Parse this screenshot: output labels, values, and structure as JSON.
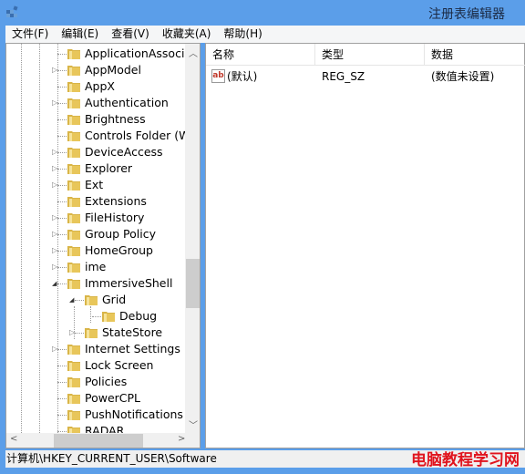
{
  "window": {
    "title": "注册表编辑器",
    "icon": "registry-editor-icon"
  },
  "menu": [
    "文件(F)",
    "编辑(E)",
    "查看(V)",
    "收藏夹(A)",
    "帮助(H)"
  ],
  "tree": [
    {
      "label": "ApplicationAssocia",
      "level": 0,
      "expander": "none"
    },
    {
      "label": "AppModel",
      "level": 0,
      "expander": "collapsed"
    },
    {
      "label": "AppX",
      "level": 0,
      "expander": "none"
    },
    {
      "label": "Authentication",
      "level": 0,
      "expander": "collapsed"
    },
    {
      "label": "Brightness",
      "level": 0,
      "expander": "none"
    },
    {
      "label": "Controls Folder (W",
      "level": 0,
      "expander": "none"
    },
    {
      "label": "DeviceAccess",
      "level": 0,
      "expander": "collapsed"
    },
    {
      "label": "Explorer",
      "level": 0,
      "expander": "collapsed"
    },
    {
      "label": "Ext",
      "level": 0,
      "expander": "collapsed"
    },
    {
      "label": "Extensions",
      "level": 0,
      "expander": "none"
    },
    {
      "label": "FileHistory",
      "level": 0,
      "expander": "collapsed"
    },
    {
      "label": "Group Policy",
      "level": 0,
      "expander": "collapsed"
    },
    {
      "label": "HomeGroup",
      "level": 0,
      "expander": "collapsed"
    },
    {
      "label": "ime",
      "level": 0,
      "expander": "collapsed"
    },
    {
      "label": "ImmersiveShell",
      "level": 0,
      "expander": "expanded"
    },
    {
      "label": "Grid",
      "level": 1,
      "expander": "expanded"
    },
    {
      "label": "Debug",
      "level": 2,
      "expander": "none"
    },
    {
      "label": "StateStore",
      "level": 1,
      "expander": "collapsed"
    },
    {
      "label": "Internet Settings",
      "level": 0,
      "expander": "collapsed"
    },
    {
      "label": "Lock Screen",
      "level": 0,
      "expander": "none"
    },
    {
      "label": "Policies",
      "level": 0,
      "expander": "none"
    },
    {
      "label": "PowerCPL",
      "level": 0,
      "expander": "none"
    },
    {
      "label": "PushNotifications",
      "level": 0,
      "expander": "none"
    },
    {
      "label": "RADAR",
      "level": 0,
      "expander": "none"
    }
  ],
  "list": {
    "columns": [
      "名称",
      "类型",
      "数据"
    ],
    "rows": [
      {
        "name": "(默认)",
        "type": "REG_SZ",
        "data": "(数值未设置)",
        "icon": "ab"
      }
    ]
  },
  "status": "计算机\\HKEY_CURRENT_USER\\Software",
  "watermark": "电脑教程学习网",
  "colors": {
    "titlebar": "#5b9ee9",
    "folder": "#e8c65a",
    "watermark": "#e0141e"
  }
}
